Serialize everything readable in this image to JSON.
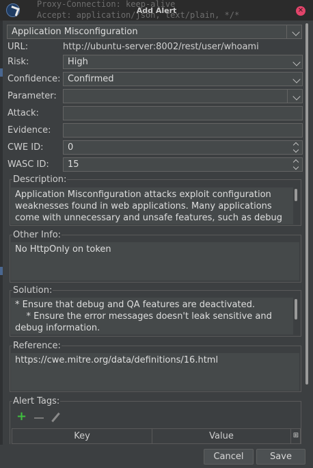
{
  "window": {
    "title": "Add Alert",
    "background_text_line1": "Proxy-Connection: keep-alive",
    "background_text_line2": "Accept: application/json, text/plain, */*"
  },
  "form": {
    "alert_name": "Application Misconfiguration",
    "url_label": "URL:",
    "url_value": "http://ubuntu-server:8002/rest/user/whoami",
    "risk_label": "Risk:",
    "risk_value": "High",
    "confidence_label": "Confidence:",
    "confidence_value": "Confirmed",
    "parameter_label": "Parameter:",
    "parameter_value": "",
    "attack_label": "Attack:",
    "attack_value": "",
    "evidence_label": "Evidence:",
    "evidence_value": "",
    "cwe_label": "CWE ID:",
    "cwe_value": "0",
    "wasc_label": "WASC ID:",
    "wasc_value": "15"
  },
  "description": {
    "title": "Description:",
    "text": "Application Misconfiguration attacks exploit configuration\nweaknesses found in web applications. Many applications\ncome with unnecessary and unsafe features, such as debug"
  },
  "other_info": {
    "title": "Other Info:",
    "text": "No HttpOnly on token"
  },
  "solution": {
    "title": "Solution:",
    "text": "* Ensure that debug and QA features are deactivated.\n    * Ensure the error messages doesn't leak sensitive and\ndebug information."
  },
  "reference": {
    "title": "Reference:",
    "text": "https://cwe.mitre.org/data/definitions/16.html"
  },
  "alert_tags": {
    "title": "Alert Tags:",
    "columns": [
      "Key",
      "Value"
    ]
  },
  "buttons": {
    "cancel": "Cancel",
    "save": "Save"
  },
  "colors": {
    "background": "#3c3f41",
    "field": "#45494a",
    "add_green": "#3fbf3f",
    "close_red": "#e2446a"
  }
}
